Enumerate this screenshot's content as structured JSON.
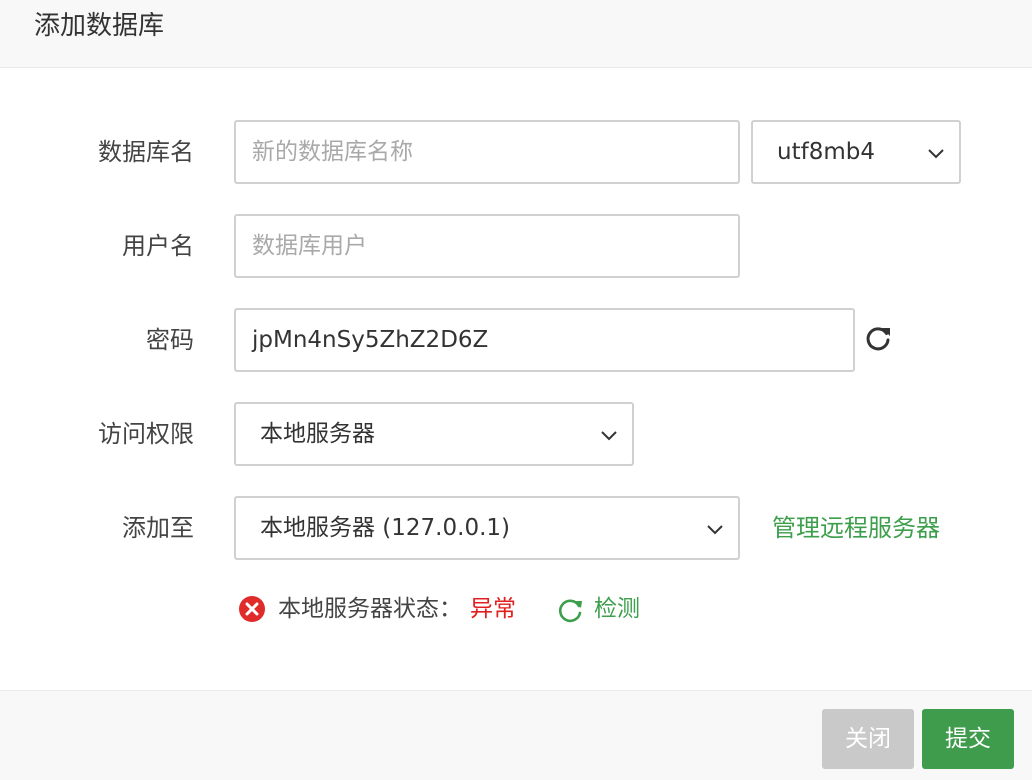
{
  "dialog": {
    "title": "添加数据库"
  },
  "form": {
    "db_name": {
      "label": "数据库名",
      "placeholder": "新的数据库名称",
      "charset": "utf8mb4"
    },
    "username": {
      "label": "用户名",
      "placeholder": "数据库用户"
    },
    "password": {
      "label": "密码",
      "value": "jpMn4nSy5ZhZ2D6Z",
      "regenerate_icon": "refresh-icon"
    },
    "access": {
      "label": "访问权限",
      "value": "本地服务器"
    },
    "add_to": {
      "label": "添加至",
      "value": "本地服务器 (127.0.0.1)",
      "manage_link": "管理远程服务器"
    },
    "status": {
      "label": "本地服务器状态：",
      "value": "异常",
      "check_label": "检测"
    }
  },
  "footer": {
    "close_label": "关闭",
    "submit_label": "提交"
  },
  "colors": {
    "accent_green": "#3f9c4c",
    "error_red": "#e02020",
    "disabled_gray": "#c9c9c9"
  }
}
